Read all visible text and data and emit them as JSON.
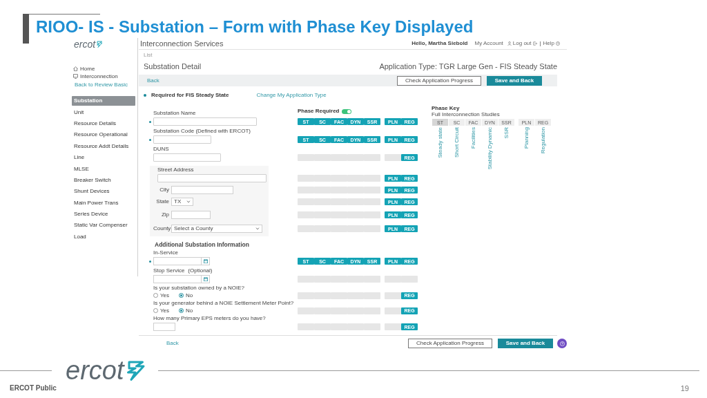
{
  "slide": {
    "title": "RIOO- IS  - Substation – Form with Phase Key Displayed",
    "logo": "ercot",
    "footer_label": "ERCOT Public",
    "page_number": "19"
  },
  "app": {
    "logo": "ercot",
    "title": "Interconnection Services",
    "user_menu": {
      "greeting": "Hello, Martha Siebold",
      "account": "My Account",
      "logout": "Log out",
      "help": "Help"
    },
    "sidebar": {
      "nav": [
        {
          "label": "Home",
          "kind": "home"
        },
        {
          "label": "Interconnection",
          "kind": "monitor"
        }
      ],
      "back_link": "Back to Review Basic",
      "items": [
        {
          "label": "Substation",
          "selected": true
        },
        {
          "label": "Unit",
          "selected": false
        },
        {
          "label": "Resource Details",
          "selected": false
        },
        {
          "label": "Resource Operational",
          "selected": false
        },
        {
          "label": "Resource Addt Details",
          "selected": false
        },
        {
          "label": "Line",
          "selected": false
        },
        {
          "label": "MLSE",
          "selected": false
        },
        {
          "label": "Breaker Switch",
          "selected": false
        },
        {
          "label": "Shunt Devices",
          "selected": false
        },
        {
          "label": "Main Power Trans",
          "selected": false
        },
        {
          "label": "Series Device",
          "selected": false
        },
        {
          "label": "Static Var Compenser",
          "selected": false
        },
        {
          "label": "Load",
          "selected": false
        }
      ]
    },
    "breadcrumb": "List",
    "page_title": "Substation Detail",
    "application_type": "Application Type: TGR Large Gen - FIS Steady State",
    "toolbar": {
      "back": "Back",
      "progress": "Check Application Progress",
      "save": "Save and Back"
    },
    "required_note": "Required for FIS Steady State",
    "change_link": "Change My Application Type",
    "phase_required": {
      "label": "Phase Required",
      "on": true
    },
    "form": {
      "basic": [
        {
          "kind": "text",
          "label": "Substation Name",
          "required": true,
          "phases": [
            {
              "label": "ST",
              "on": true
            },
            {
              "label": "SC",
              "on": true
            },
            {
              "label": "FAC",
              "on": true
            },
            {
              "label": "DYN",
              "on": true
            },
            {
              "label": "SSR",
              "on": true
            },
            {
              "label": "PLN",
              "on": true
            },
            {
              "label": "REG",
              "on": true
            }
          ]
        },
        {
          "kind": "text",
          "label": "Substation Code (Defined with ERCOT)",
          "required": true,
          "phases": [
            {
              "label": "ST",
              "on": true
            },
            {
              "label": "SC",
              "on": true
            },
            {
              "label": "FAC",
              "on": true
            },
            {
              "label": "DYN",
              "on": true
            },
            {
              "label": "SSR",
              "on": true
            },
            {
              "label": "PLN",
              "on": true
            },
            {
              "label": "REG",
              "on": true
            }
          ]
        },
        {
          "kind": "text",
          "label": "DUNS",
          "required": false,
          "phases": [
            {
              "on": false
            },
            {
              "on": false
            },
            {
              "on": false
            },
            {
              "on": false
            },
            {
              "on": false
            },
            {
              "on": false
            },
            {
              "label": "REG",
              "on": true
            }
          ]
        }
      ],
      "address": [
        {
          "kind": "text",
          "label": "Street Address",
          "required": false,
          "phases": [
            {
              "on": false
            },
            {
              "on": false
            },
            {
              "on": false
            },
            {
              "on": false
            },
            {
              "on": false
            },
            {
              "label": "PLN",
              "on": true
            },
            {
              "label": "REG",
              "on": true
            }
          ]
        },
        {
          "kind": "inline_text",
          "label": "City",
          "phases": [
            {
              "on": false
            },
            {
              "on": false
            },
            {
              "on": false
            },
            {
              "on": false
            },
            {
              "on": false
            },
            {
              "label": "PLN",
              "on": true
            },
            {
              "label": "REG",
              "on": true
            }
          ]
        },
        {
          "kind": "inline_select",
          "label": "State",
          "value": "TX",
          "phases": [
            {
              "on": false
            },
            {
              "on": false
            },
            {
              "on": false
            },
            {
              "on": false
            },
            {
              "on": false
            },
            {
              "label": "PLN",
              "on": true
            },
            {
              "label": "REG",
              "on": true
            }
          ]
        },
        {
          "kind": "inline_text",
          "label": "Zip",
          "phases": [
            {
              "on": false
            },
            {
              "on": false
            },
            {
              "on": false
            },
            {
              "on": false
            },
            {
              "on": false
            },
            {
              "label": "PLN",
              "on": true
            },
            {
              "label": "REG",
              "on": true
            }
          ]
        },
        {
          "kind": "inline_select",
          "label": "County",
          "value": "Select a County",
          "phases": [
            {
              "on": false
            },
            {
              "on": false
            },
            {
              "on": false
            },
            {
              "on": false
            },
            {
              "on": false
            },
            {
              "label": "PLN",
              "on": true
            },
            {
              "label": "REG",
              "on": true
            }
          ]
        }
      ],
      "additional_title": "Additional Substation Information",
      "additional": [
        {
          "kind": "date",
          "label": "In-Service",
          "required": true,
          "phases": [
            {
              "label": "ST",
              "on": true
            },
            {
              "label": "SC",
              "on": true
            },
            {
              "label": "FAC",
              "on": true
            },
            {
              "label": "DYN",
              "on": true
            },
            {
              "label": "SSR",
              "on": true
            },
            {
              "label": "PLN",
              "on": true
            },
            {
              "label": "REG",
              "on": true
            }
          ]
        },
        {
          "kind": "date",
          "label": "Stop Service",
          "note": "(Optional)",
          "required": false,
          "phases": [
            {
              "on": false
            },
            {
              "on": false
            },
            {
              "on": false
            },
            {
              "on": false
            },
            {
              "on": false
            },
            {
              "on": false
            },
            {
              "on": false
            }
          ]
        },
        {
          "kind": "radio",
          "label": "Is your substation owned by a NOIE?",
          "options": [
            {
              "label": "Yes",
              "selected": false
            },
            {
              "label": "No",
              "selected": true
            }
          ],
          "phases": [
            {
              "on": false
            },
            {
              "on": false
            },
            {
              "on": false
            },
            {
              "on": false
            },
            {
              "on": false
            },
            {
              "on": false
            },
            {
              "label": "REG",
              "on": true
            }
          ]
        },
        {
          "kind": "radio",
          "label": "Is your generator behind a NOIE Settlement  Meter Point?",
          "options": [
            {
              "label": "Yes",
              "selected": false
            },
            {
              "label": "No",
              "selected": true
            }
          ],
          "phases": [
            {
              "on": false
            },
            {
              "on": false
            },
            {
              "on": false
            },
            {
              "on": false
            },
            {
              "on": false
            },
            {
              "on": false
            },
            {
              "label": "REG",
              "on": true
            }
          ]
        },
        {
          "kind": "number",
          "label": "How many Primary EPS meters do you have?",
          "phases": [
            {
              "on": false
            },
            {
              "on": false
            },
            {
              "on": false
            },
            {
              "on": false
            },
            {
              "on": false
            },
            {
              "on": false
            },
            {
              "label": "REG",
              "on": true
            }
          ]
        }
      ]
    },
    "phase_key": {
      "title": "Phase Key",
      "subtitle": "Full Interconnection Studies",
      "columns": [
        {
          "code": "ST",
          "name": "Steady state",
          "selected": true
        },
        {
          "code": "SC",
          "name": "Short Circuit",
          "selected": false
        },
        {
          "code": "FAC",
          "name": "Facilities",
          "selected": false
        },
        {
          "code": "DYN",
          "name": "Stability Dynamic",
          "selected": false
        },
        {
          "code": "SSR",
          "name": "SSR",
          "selected": false
        },
        {
          "code": "PLN",
          "name": "Planning",
          "selected": false
        },
        {
          "code": "REG",
          "name": "Regulation",
          "selected": false
        }
      ]
    },
    "footer": {
      "back": "Back",
      "progress": "Check Application Progress",
      "save": "Save and Back"
    }
  }
}
